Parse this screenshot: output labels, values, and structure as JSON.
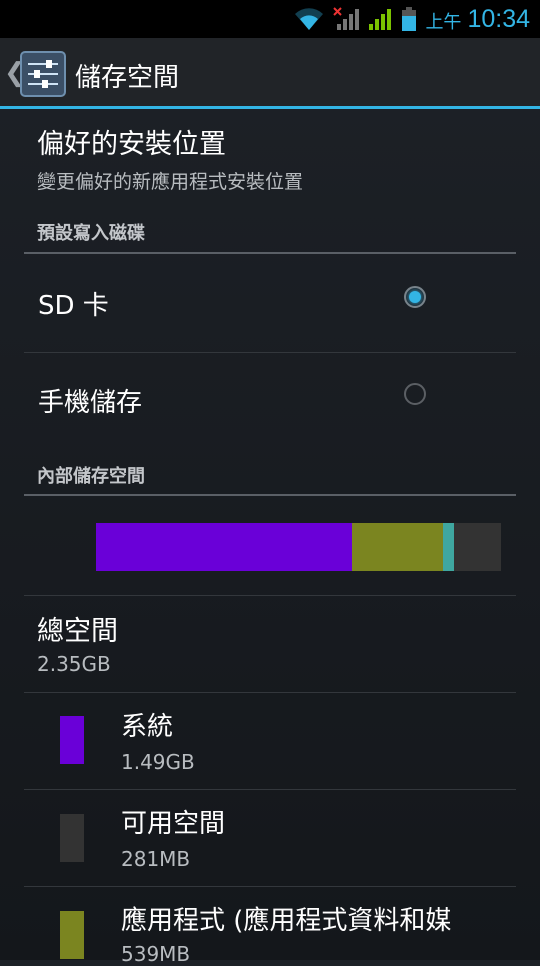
{
  "status_bar": {
    "ampm": "上午",
    "time": "10:34",
    "icons": [
      "wifi-icon",
      "no-sim-signal-icon",
      "signal-icon",
      "battery-icon"
    ]
  },
  "action_bar": {
    "title": "儲存空間",
    "icon": "settings-sliders-icon",
    "up_glyph": "❮"
  },
  "install_location": {
    "title": "偏好的安裝位置",
    "summary": "變更偏好的新應用程式安裝位置"
  },
  "default_disk": {
    "category": "預設寫入磁碟",
    "options": [
      {
        "label": "SD 卡",
        "checked": true
      },
      {
        "label": "手機儲存",
        "checked": false
      }
    ]
  },
  "internal_storage": {
    "category": "內部儲存空間",
    "bar_segments": [
      {
        "name": "system",
        "color": "#6a00d8",
        "fraction": 0.633
      },
      {
        "name": "apps",
        "color": "#7b8520",
        "fraction": 0.224
      },
      {
        "name": "other",
        "color": "#3fa7a0",
        "fraction": 0.027
      },
      {
        "name": "available",
        "color": "#333333",
        "fraction": 0.116
      }
    ],
    "total": {
      "title": "總空間",
      "value": "2.35GB"
    },
    "items": [
      {
        "title": "系統",
        "value": "1.49GB",
        "color": "#6a00d8"
      },
      {
        "title": "可用空間",
        "value": "281MB",
        "color": "#333333"
      },
      {
        "title": "應用程式 (應用程式資料和媒",
        "value": "539MB",
        "color": "#7b8520"
      }
    ]
  }
}
